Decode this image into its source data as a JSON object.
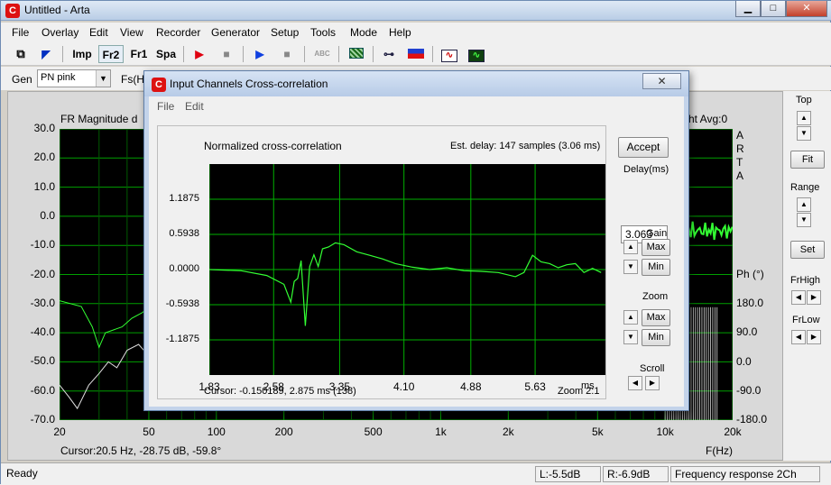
{
  "window": {
    "title": "Untitled - Arta"
  },
  "menu": [
    "File",
    "Overlay",
    "Edit",
    "View",
    "Recorder",
    "Generator",
    "Setup",
    "Tools",
    "Mode",
    "Help"
  ],
  "toolbar": {
    "imp": "Imp",
    "fr2": "Fr2",
    "fr1": "Fr1",
    "spa": "Spa",
    "abc": "ABC"
  },
  "gen": {
    "label": "Gen",
    "value": "PN pink",
    "fs_label": "Fs(Hz"
  },
  "main_plot": {
    "title_fragment": "FR Magnitude d",
    "right_fragment": "ht  Avg:0",
    "y_labels": [
      "30.0",
      "20.0",
      "10.0",
      "0.0",
      "-10.0",
      "-20.0",
      "-30.0",
      "-40.0",
      "-50.0",
      "-60.0",
      "-70.0"
    ],
    "x_labels": [
      "20",
      "50",
      "100",
      "200",
      "500",
      "1k",
      "2k",
      "5k",
      "10k",
      "20k"
    ],
    "x_unit": "F(Hz)",
    "phase_title": "Ph (°)",
    "phase_labels": [
      "180.0",
      "90.0",
      "0.0",
      "-90.0",
      "-180.0"
    ],
    "arta_letters": [
      "A",
      "R",
      "T",
      "A"
    ],
    "cursor": "Cursor:20.5 Hz, -28.75 dB, -59.8°"
  },
  "side_panel": {
    "top": "Top",
    "fit": "Fit",
    "range": "Range",
    "set": "Set",
    "frhigh": "FrHigh",
    "frlow": "FrLow"
  },
  "status": {
    "ready": "Ready",
    "left": "L:-5.5dB",
    "right": "R:-6.9dB",
    "mode": "Frequency response 2Ch"
  },
  "dialog": {
    "title": "Input Channels Cross-correlation",
    "close": "✕",
    "menu": [
      "File",
      "Edit"
    ],
    "plot_title": "Normalized cross-correlation",
    "est_delay": "Est. delay: 147 samples (3.06 ms)",
    "cursor": "Cursor: -0.150189,  2.875 ms  (138)",
    "zoom_info": "Zoom 2:1",
    "accept": "Accept",
    "delay_label": "Delay(ms)",
    "delay_value": "3.063",
    "gain_label": "Gain",
    "zoom_label": "Zoom",
    "scroll_label": "Scroll",
    "max": "Max",
    "min": "Min"
  },
  "chart_data": {
    "type": "line",
    "title": "Normalized cross-correlation",
    "xlabel": "ms",
    "ylabel": "",
    "x_ticks": [
      "1.83",
      "2.58",
      "3.35",
      "4.10",
      "4.88",
      "5.63"
    ],
    "y_ticks": [
      "1.1875",
      "0.5938",
      "0.0000",
      "-0.5938",
      "-1.1875"
    ],
    "xlim": [
      1.83,
      6.45
    ],
    "ylim": [
      -1.78,
      1.78
    ],
    "series": [
      {
        "x": [
          1.83,
          2.2,
          2.5,
          2.7,
          2.78,
          2.82,
          2.86,
          2.9,
          2.95,
          3.0,
          3.05,
          3.1,
          3.15,
          3.22,
          3.3,
          3.4,
          3.55,
          3.7,
          3.85,
          4.0,
          4.2,
          4.4,
          4.6,
          4.8,
          5.0,
          5.2,
          5.4,
          5.5,
          5.6,
          5.7,
          5.8,
          5.9,
          6.0,
          6.1,
          6.2,
          6.3,
          6.4
        ],
        "y": [
          0.0,
          -0.02,
          -0.1,
          -0.25,
          -0.55,
          -0.2,
          -0.15,
          0.15,
          -0.95,
          0.05,
          0.25,
          0.05,
          0.35,
          0.38,
          0.45,
          0.42,
          0.3,
          0.24,
          0.18,
          0.1,
          0.04,
          0.0,
          0.03,
          -0.02,
          -0.03,
          -0.05,
          -0.12,
          -0.05,
          0.24,
          0.13,
          0.1,
          0.03,
          0.08,
          0.1,
          -0.05,
          0.02,
          -0.05
        ]
      }
    ],
    "grid": true,
    "colors": {
      "line": "#33ff33",
      "grid": "#00b000",
      "background": "#000000"
    }
  }
}
